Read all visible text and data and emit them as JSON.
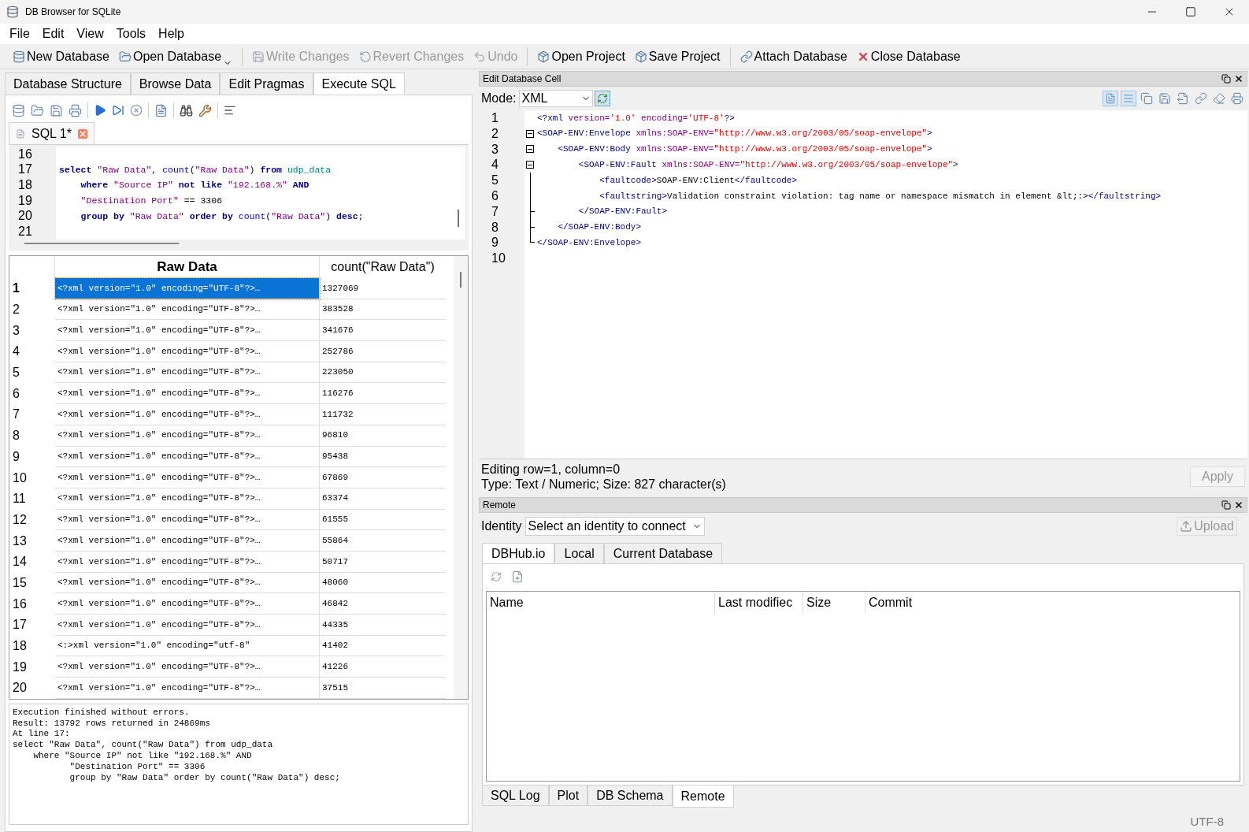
{
  "window": {
    "title": "DB Browser for SQLite"
  },
  "menu": [
    "File",
    "Edit",
    "View",
    "Tools",
    "Help"
  ],
  "toolbar": [
    {
      "label": "New Database",
      "disabled": false,
      "kind": "plain"
    },
    {
      "label": "Open Database",
      "disabled": false,
      "kind": "dropdown"
    },
    {
      "label": "Write Changes",
      "disabled": true,
      "kind": "plain"
    },
    {
      "label": "Revert Changes",
      "disabled": true,
      "kind": "plain"
    },
    {
      "label": "Undo",
      "disabled": true,
      "kind": "plain"
    },
    {
      "label": "Open Project",
      "disabled": false,
      "kind": "plain"
    },
    {
      "label": "Save Project",
      "disabled": false,
      "kind": "plain"
    },
    {
      "label": "Attach Database",
      "disabled": false,
      "kind": "plain"
    },
    {
      "label": "Close Database",
      "disabled": false,
      "kind": "close"
    }
  ],
  "main_tabs": [
    {
      "label": "Database Structure",
      "selected": false
    },
    {
      "label": "Browse Data",
      "selected": false
    },
    {
      "label": "Edit Pragmas",
      "selected": false
    },
    {
      "label": "Execute SQL",
      "selected": true
    }
  ],
  "sql_tab": {
    "label": "SQL 1*"
  },
  "sql_editor": [
    {
      "number": "16"
    },
    {
      "number": "17",
      "tokens": [
        {
          "text": "select",
          "kind": "keyword"
        },
        {
          "text": " \"Raw Data\"",
          "kind": "string"
        },
        {
          "text": ", ",
          "kind": "plain"
        },
        {
          "text": "count",
          "kind": "function"
        },
        {
          "text": "(",
          "kind": "plain"
        },
        {
          "text": "\"Raw Data\"",
          "kind": "string"
        },
        {
          "text": ") ",
          "kind": "plain"
        },
        {
          "text": "from",
          "kind": "keyword"
        },
        {
          "text": " udp_data",
          "kind": "table"
        }
      ]
    },
    {
      "number": "18",
      "tokens": [
        {
          "text": "    where",
          "kind": "keyword"
        },
        {
          "text": " \"Source IP\" ",
          "kind": "string"
        },
        {
          "text": "not like",
          "kind": "keyword"
        },
        {
          "text": " \"192.168.%\" ",
          "kind": "string"
        },
        {
          "text": "AND",
          "kind": "keyword"
        }
      ]
    },
    {
      "number": "19",
      "tokens": [
        {
          "text": "    \"Destination Port\"",
          "kind": "string"
        },
        {
          "text": " == 3306",
          "kind": "plain"
        }
      ]
    },
    {
      "number": "20",
      "tokens": [
        {
          "text": "    group by",
          "kind": "keyword"
        },
        {
          "text": " \"Raw Data\" ",
          "kind": "string"
        },
        {
          "text": "order by",
          "kind": "keyword"
        },
        {
          "text": " count",
          "kind": "function"
        },
        {
          "text": "(",
          "kind": "plain"
        },
        {
          "text": "\"Raw Data\"",
          "kind": "string"
        },
        {
          "text": ") ",
          "kind": "plain"
        },
        {
          "text": "desc",
          "kind": "keyword"
        },
        {
          "text": ";",
          "kind": "plain"
        }
      ]
    },
    {
      "number": "21"
    }
  ],
  "results": {
    "columns": [
      "Raw Data",
      "count(\"Raw Data\")"
    ],
    "rows": [
      {
        "number": "1",
        "raw": "<?xml version=\"1.0\" encoding=\"UTF-8\"?>…",
        "count": "1327069",
        "selected": true
      },
      {
        "number": "2",
        "raw": "<?xml version=\"1.0\" encoding=\"UTF-8\"?>…",
        "count": "383528",
        "selected": false
      },
      {
        "number": "3",
        "raw": "<?xml version=\"1.0\" encoding=\"UTF-8\"?>…",
        "count": "341676",
        "selected": false
      },
      {
        "number": "4",
        "raw": "<?xml version=\"1.0\" encoding=\"UTF-8\"?>…",
        "count": "252786",
        "selected": false
      },
      {
        "number": "5",
        "raw": "<?xml version=\"1.0\" encoding=\"UTF-8\"?>…",
        "count": "223050",
        "selected": false
      },
      {
        "number": "6",
        "raw": "<?xml version=\"1.0\" encoding=\"UTF-8\"?>…",
        "count": "116276",
        "selected": false
      },
      {
        "number": "7",
        "raw": "<?xml version=\"1.0\" encoding=\"UTF-8\"?>…",
        "count": "111732",
        "selected": false
      },
      {
        "number": "8",
        "raw": "<?xml version=\"1.0\" encoding=\"UTF-8\"?>…",
        "count": "96810",
        "selected": false
      },
      {
        "number": "9",
        "raw": "<?xml version=\"1.0\" encoding=\"UTF-8\"?>…",
        "count": "95438",
        "selected": false
      },
      {
        "number": "10",
        "raw": "<?xml version=\"1.0\" encoding=\"UTF-8\"?>…",
        "count": "67869",
        "selected": false
      },
      {
        "number": "11",
        "raw": "<?xml version=\"1.0\" encoding=\"UTF-8\"?>…",
        "count": "63374",
        "selected": false
      },
      {
        "number": "12",
        "raw": "<?xml version=\"1.0\" encoding=\"UTF-8\"?>…",
        "count": "61555",
        "selected": false
      },
      {
        "number": "13",
        "raw": "<?xml version=\"1.0\" encoding=\"UTF-8\"?>…",
        "count": "55864",
        "selected": false
      },
      {
        "number": "14",
        "raw": "<?xml version=\"1.0\" encoding=\"UTF-8\"?>…",
        "count": "50717",
        "selected": false
      },
      {
        "number": "15",
        "raw": "<?xml version=\"1.0\" encoding=\"UTF-8\"?>…",
        "count": "48060",
        "selected": false
      },
      {
        "number": "16",
        "raw": "<?xml version=\"1.0\" encoding=\"UTF-8\"?>…",
        "count": "46842",
        "selected": false
      },
      {
        "number": "17",
        "raw": "<?xml version=\"1.0\" encoding=\"UTF-8\"?>…",
        "count": "44335",
        "selected": false
      },
      {
        "number": "18",
        "raw": "<:>xml version=\"1.0\" encoding=\"utf-8\"",
        "count": "41402",
        "selected": false
      },
      {
        "number": "19",
        "raw": "<?xml version=\"1.0\" encoding=\"UTF-8\"?>…",
        "count": "41226",
        "selected": false
      },
      {
        "number": "20",
        "raw": "<?xml version=\"1.0\" encoding=\"UTF-8\"?>…",
        "count": "37515",
        "selected": false
      }
    ]
  },
  "message": [
    "Execution finished without errors.",
    "Result: 13792 rows returned in 24869ms",
    "At line 17:",
    "select \"Raw Data\", count(\"Raw Data\") from udp_data",
    "    where \"Source IP\" not like \"192.168.%\" AND",
    "           \"Destination Port\" == 3306",
    "           group by \"Raw Data\" order by count(\"Raw Data\") desc;"
  ],
  "edit_cell": {
    "title": "Edit Database Cell",
    "mode_label": "Mode:",
    "mode": "XML",
    "lines": [
      {
        "number": "1",
        "kind": "plain",
        "tokens": [
          {
            "text": "<?xml",
            "kind": "tag"
          },
          {
            "text": " version=",
            "kind": "attr"
          },
          {
            "text": "'1.0'",
            "kind": "value"
          },
          {
            "text": " encoding=",
            "kind": "attr"
          },
          {
            "text": "'UTF-8'",
            "kind": "value"
          },
          {
            "text": "?>",
            "kind": "tag"
          }
        ]
      },
      {
        "number": "2",
        "kind": "open",
        "tokens": [
          {
            "text": "<SOAP-ENV:Envelope",
            "kind": "tag"
          },
          {
            "text": " xmlns:SOAP-ENV=",
            "kind": "attr"
          },
          {
            "text": "\"http://www.w3.org/2003/05/soap-envelope\"",
            "kind": "value"
          },
          {
            "text": ">",
            "kind": "tag"
          }
        ]
      },
      {
        "number": "3",
        "kind": "open",
        "tokens": [
          {
            "text": "    <SOAP-ENV:Body",
            "kind": "tag"
          },
          {
            "text": " xmlns:SOAP-ENV=",
            "kind": "attr"
          },
          {
            "text": "\"http://www.w3.org/2003/05/soap-envelope\"",
            "kind": "value"
          },
          {
            "text": ">",
            "kind": "tag"
          }
        ]
      },
      {
        "number": "4",
        "kind": "open",
        "tokens": [
          {
            "text": "        <SOAP-ENV:Fault",
            "kind": "tag"
          },
          {
            "text": " xmlns:SOAP-ENV=",
            "kind": "attr"
          },
          {
            "text": "\"http://www.w3.org/2003/05/soap-envelope\"",
            "kind": "value"
          },
          {
            "text": ">",
            "kind": "tag"
          }
        ]
      },
      {
        "number": "5",
        "kind": "line",
        "tokens": [
          {
            "text": "            <faultcode>",
            "kind": "tag"
          },
          {
            "text": "SOAP-ENV:Client",
            "kind": "text"
          },
          {
            "text": "</faultcode>",
            "kind": "tag"
          }
        ]
      },
      {
        "number": "6",
        "kind": "line",
        "tokens": [
          {
            "text": "            <faultstring>",
            "kind": "tag"
          },
          {
            "text": "Validation constraint violation: tag name or namespace mismatch in element &lt;:>",
            "kind": "text"
          },
          {
            "text": "</faultstring>",
            "kind": "tag"
          }
        ]
      },
      {
        "number": "7",
        "kind": "close",
        "tokens": [
          {
            "text": "        </SOAP-ENV:Fault>",
            "kind": "tag"
          }
        ]
      },
      {
        "number": "8",
        "kind": "close",
        "tokens": [
          {
            "text": "    </SOAP-ENV:Body>",
            "kind": "tag"
          }
        ]
      },
      {
        "number": "9",
        "kind": "end",
        "tokens": [
          {
            "text": "</SOAP-ENV:Envelope>",
            "kind": "tag"
          }
        ]
      },
      {
        "number": "10",
        "kind": "plain"
      }
    ],
    "info": [
      "Editing row=1, column=0",
      "Type: Text / Numeric; Size: 827 character(s)"
    ],
    "apply": {
      "label": "Apply",
      "disabled": true
    }
  },
  "remote": {
    "title": "Remote",
    "identity_label": "Identity",
    "identity": "Select an identity to connect",
    "upload": {
      "label": "Upload",
      "disabled": true
    },
    "tabs": [
      {
        "label": "DBHub.io",
        "selected": true
      },
      {
        "label": "Local",
        "selected": false
      },
      {
        "label": "Current Database",
        "selected": false
      }
    ],
    "columns": [
      "Name",
      "Last modifiec",
      "Size",
      "Commit"
    ]
  },
  "bottom_tabs": [
    {
      "label": "SQL Log",
      "selected": false
    },
    {
      "label": "Plot",
      "selected": false
    },
    {
      "label": "DB Schema",
      "selected": false
    },
    {
      "label": "Remote",
      "selected": true
    }
  ],
  "status_bar": {
    "encoding": "UTF-8"
  }
}
